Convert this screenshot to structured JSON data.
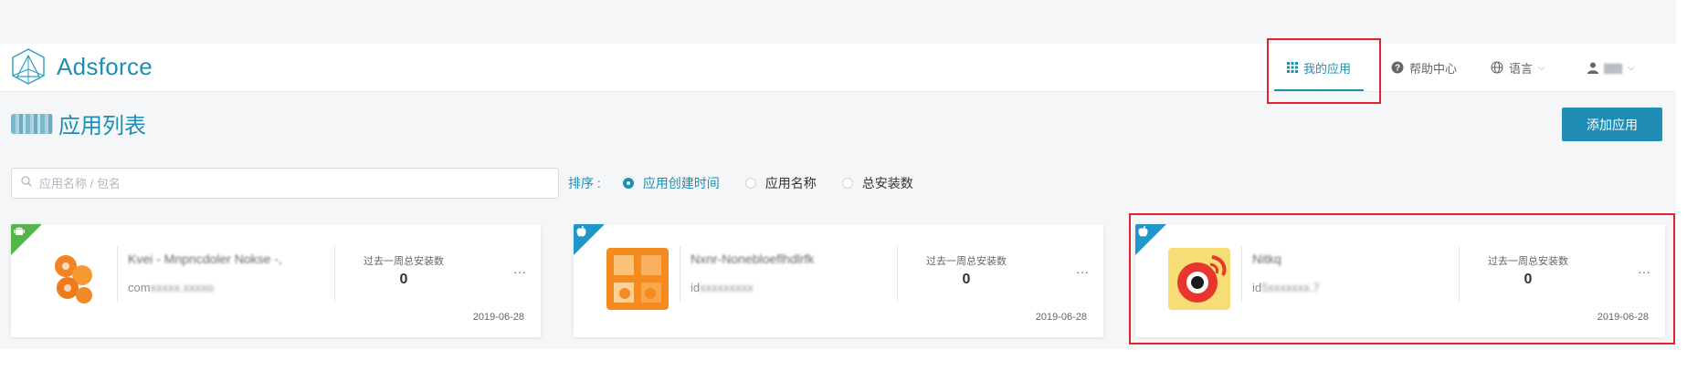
{
  "header": {
    "brand": "Adsforce",
    "nav": {
      "my_apps": "我的应用",
      "help": "帮助中心",
      "language": "语言",
      "user": "▆▆"
    }
  },
  "page": {
    "title": "应用列表",
    "add_button": "添加应用",
    "search_placeholder": "应用名称 / 包名",
    "sort": {
      "label": "排序 :",
      "options": [
        "应用创建时间",
        "应用名称",
        "总安装数"
      ],
      "selected": "应用创建时间"
    }
  },
  "cards": [
    {
      "platform": "android",
      "name": "Kvei - Mnpncdoler Nokse -,",
      "id_prefix": "com",
      "id_blur": "xxxxx.xxxxo",
      "stat_label": "过去一周总安装数",
      "stat_value": "0",
      "more": "···",
      "date": "2019-06-28"
    },
    {
      "platform": "ios",
      "name": "Nxnr-Nonebloeflhdlrfk",
      "id_prefix": "id",
      "id_blur": "xxxxxxxxx",
      "stat_label": "过去一周总安装数",
      "stat_value": "0",
      "more": "···",
      "date": "2019-06-28"
    },
    {
      "platform": "ios",
      "name": "Nitkq",
      "id_prefix": "id",
      "id_blur": "5xxxxxxx.7",
      "stat_label": "过去一周总安装数",
      "stat_value": "0",
      "more": "···",
      "date": "2019-06-28"
    }
  ],
  "colors": {
    "accent": "#1e8fb4",
    "button": "#1f8db6",
    "android_ribbon": "#56b54a",
    "ios_ribbon": "#2196c9",
    "highlight_box": "#e0242b"
  }
}
